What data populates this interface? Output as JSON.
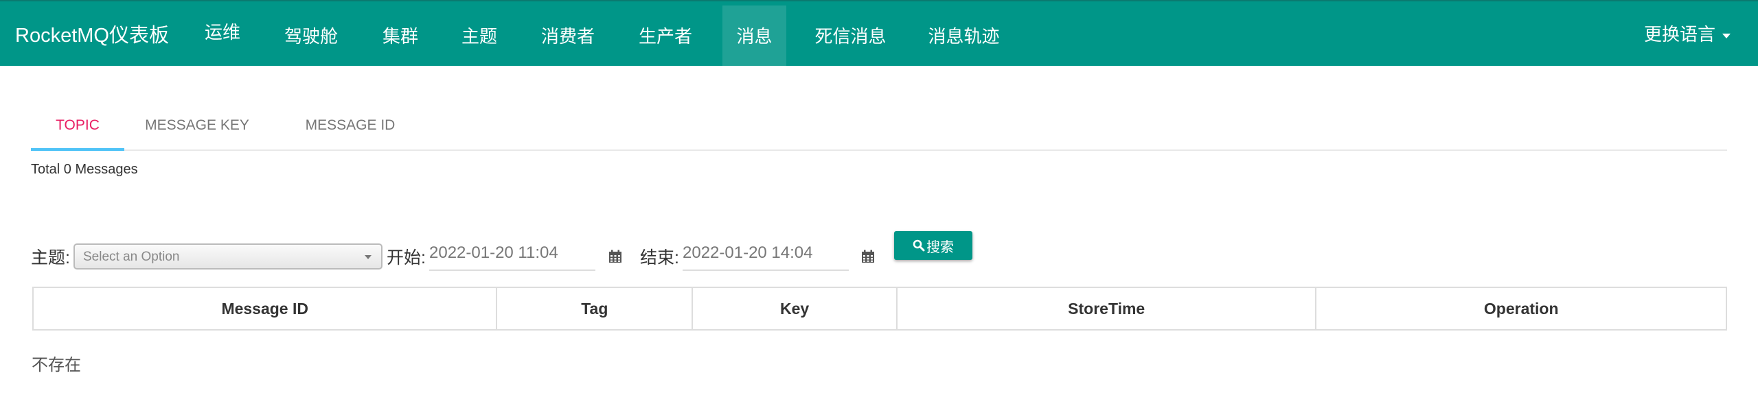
{
  "navbar": {
    "brand": "RocketMQ仪表板",
    "items": [
      {
        "label": "运维"
      },
      {
        "label": "驾驶舱"
      },
      {
        "label": "集群"
      },
      {
        "label": "主题"
      },
      {
        "label": "消费者"
      },
      {
        "label": "生产者"
      },
      {
        "label": "消息",
        "active": true
      },
      {
        "label": "死信消息"
      },
      {
        "label": "消息轨迹"
      }
    ],
    "language": "更换语言"
  },
  "tabs": [
    {
      "label": "TOPIC",
      "active": true
    },
    {
      "label": "MESSAGE KEY"
    },
    {
      "label": "MESSAGE ID"
    }
  ],
  "total_text": "Total 0 Messages",
  "form": {
    "topic_label": "主题:",
    "topic_placeholder": "Select an Option",
    "start_label": "开始:",
    "start_value": "2022-01-20 11:04",
    "end_label": "结束:",
    "end_value": "2022-01-20 14:04",
    "search_label": "搜索"
  },
  "table": {
    "columns": [
      "Message ID",
      "Tag",
      "Key",
      "StoreTime",
      "Operation"
    ]
  },
  "empty_text": "不存在",
  "colors": {
    "primary": "#009688",
    "tab_active_text": "#e91e63",
    "tab_indicator": "#4fc3f7"
  }
}
